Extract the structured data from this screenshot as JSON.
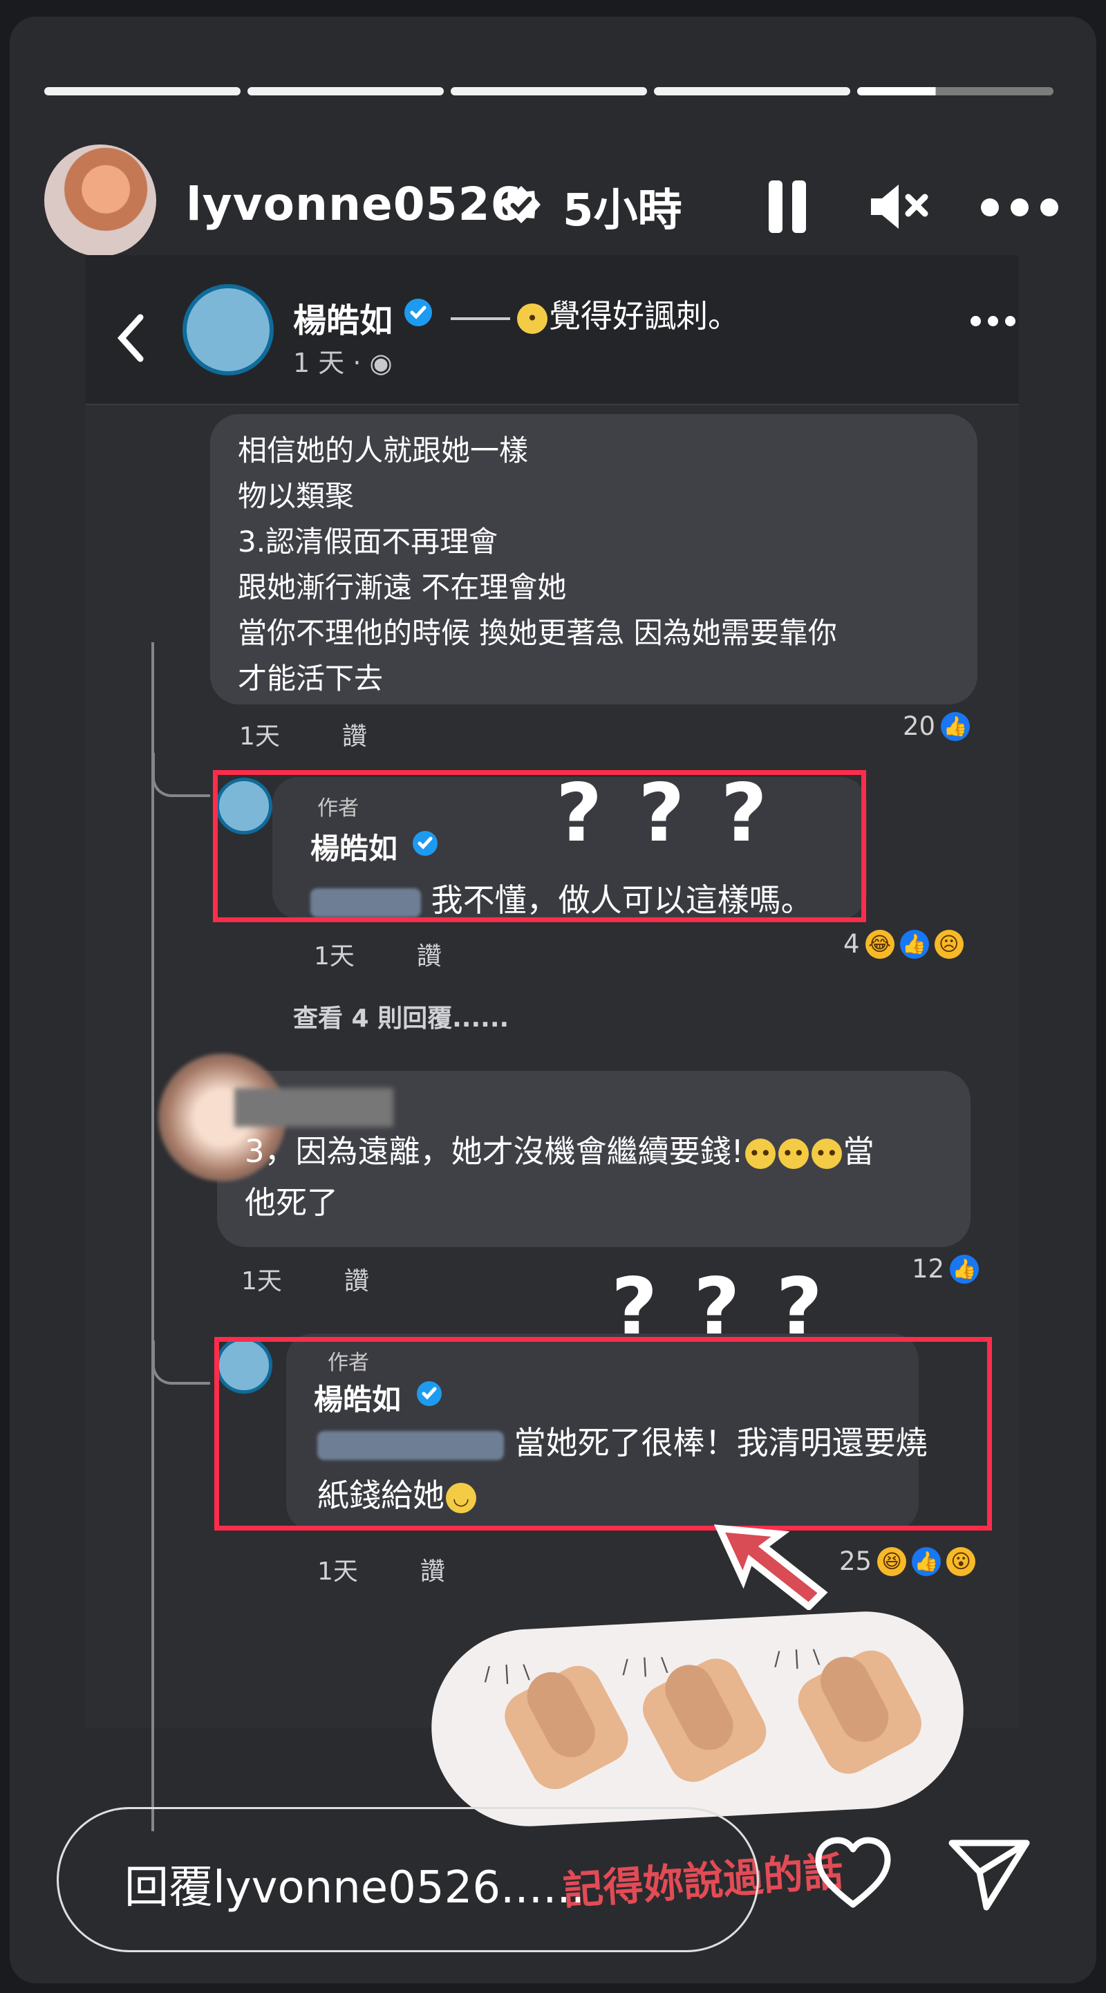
{
  "story": {
    "username": "lyvonne0526",
    "time": "5小時"
  },
  "facebook_post": {
    "author": "楊皓如",
    "status": "覺得好諷刺。",
    "time": "1 天 ·"
  },
  "comments": [
    {
      "text_lines": [
        "相信她的人就跟她一樣",
        "物以類聚",
        "3.認清假面不再理會",
        "跟她漸行漸遠 不在理會她",
        "當你不理他的時候 換她更著急 因為她需要靠你",
        "才能活下去"
      ],
      "meta": "1天",
      "action": "讚",
      "reaction_count": "20"
    },
    {
      "tag": "作者",
      "name": "楊皓如",
      "text": "我不懂，做人可以這樣嗎。",
      "meta": "1天",
      "action": "讚",
      "reaction_count": "4",
      "view_replies": "查看 4 則回覆......",
      "annotation": "???"
    },
    {
      "text": "3，因為遠離，她才沒機會繼續要錢!",
      "suffix": "當",
      "line2": "他死了",
      "meta": "1天",
      "action": "讚",
      "reaction_count": "12"
    },
    {
      "tag": "作者",
      "name": "楊皓如",
      "text": "當她死了很棒！我清明還要燒",
      "line2": "紙錢給她",
      "meta": "1天",
      "action": "讚",
      "reaction_count": "25",
      "annotation": "???"
    }
  ],
  "sticker": {
    "caption": "記得妳說過的話"
  },
  "composer": {
    "placeholder": "回覆lyvonne0526......"
  },
  "icons": {
    "back": "chevron-left-icon",
    "verified": "verified-icon",
    "pause": "pause-icon",
    "mute": "mute-icon",
    "more": "more-icon",
    "heart": "heart-icon",
    "send": "send-icon"
  },
  "colors": {
    "highlight": "#ff2d4b",
    "verified": "#1d9bf0",
    "like": "#1877f2"
  }
}
